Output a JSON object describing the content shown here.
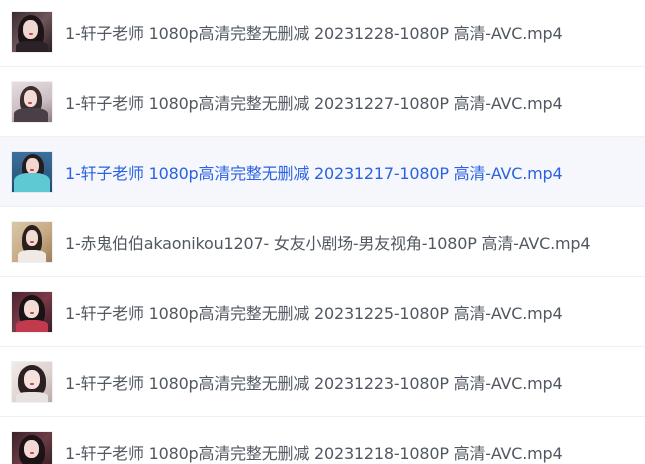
{
  "files": [
    {
      "name": "1-轩子老师 1080p高清完整无删减 20231228-1080P 高清-AVC.mp4",
      "thumbnail": "video-thumbnail",
      "selected": false
    },
    {
      "name": "1-轩子老师 1080p高清完整无删减 20231227-1080P 高清-AVC.mp4",
      "thumbnail": "video-thumbnail",
      "selected": false
    },
    {
      "name": "1-轩子老师 1080p高清完整无删减 20231217-1080P 高清-AVC.mp4",
      "thumbnail": "video-thumbnail",
      "selected": true
    },
    {
      "name": "1-赤鬼伯伯akaonikou1207- 女友小剧场-男友视角-1080P 高清-AVC.mp4",
      "thumbnail": "video-thumbnail",
      "selected": false
    },
    {
      "name": "1-轩子老师 1080p高清完整无删减 20231225-1080P 高清-AVC.mp4",
      "thumbnail": "video-thumbnail",
      "selected": false
    },
    {
      "name": "1-轩子老师 1080p高清完整无删减 20231223-1080P 高清-AVC.mp4",
      "thumbnail": "video-thumbnail",
      "selected": false
    },
    {
      "name": "1-轩子老师 1080p高清完整无删减 20231218-1080P 高清-AVC.mp4",
      "thumbnail": "video-thumbnail",
      "selected": false
    }
  ],
  "colors": {
    "text": "#525861",
    "selected_text": "#2a62e0",
    "selected_background": "#f5f7fd",
    "divider": "#eef0f3"
  }
}
